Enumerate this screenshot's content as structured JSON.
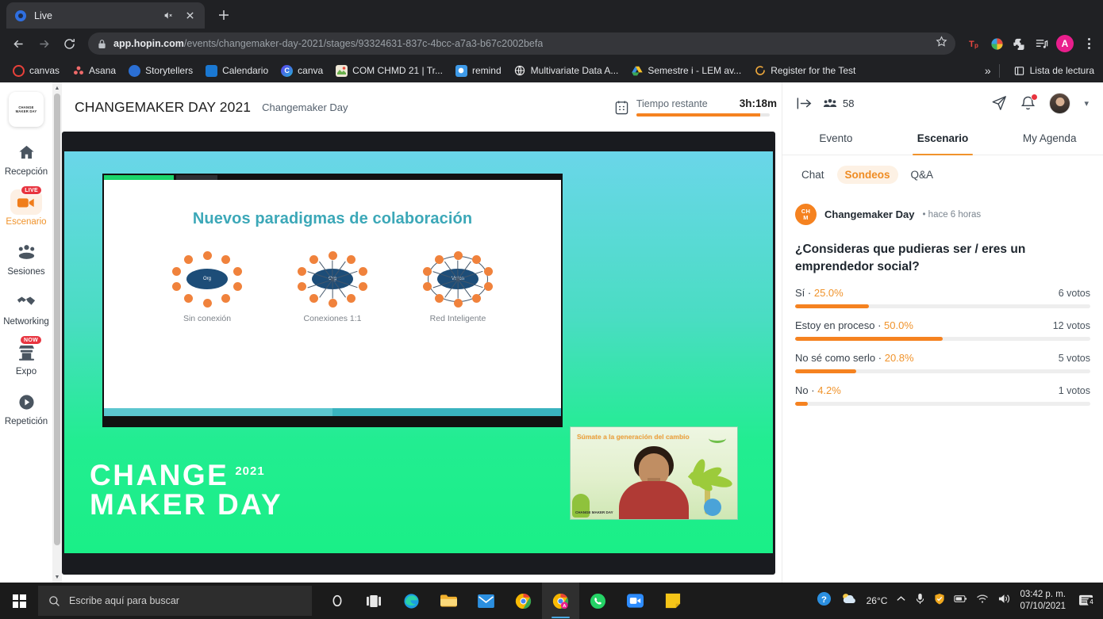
{
  "browser": {
    "tab": {
      "title": "Live",
      "favicon": "hopin-icon",
      "mute_icon": "mute-icon",
      "close_icon": "close-icon"
    },
    "newtab_icon": "plus-icon",
    "nav": {
      "back_icon": "back-arrow-icon",
      "forward_icon": "forward-arrow-icon",
      "reload_icon": "reload-icon"
    },
    "omnibox": {
      "lock_icon": "lock-icon",
      "url_host": "app.hopin.com",
      "url_path": "/events/changemaker-day-2021/stages/93324631-837c-4bcc-a7a3-b67c2002befa",
      "star_icon": "bookmark-star-icon"
    },
    "extensions": [
      {
        "name": "todoist-extension",
        "glyph": "Tp",
        "color": "#e8473f"
      },
      {
        "name": "color-extension",
        "glyph": "",
        "color": "#22a3e0"
      },
      {
        "name": "puzzle-extensions-icon",
        "glyph": "",
        "color": "#d7d9dc"
      },
      {
        "name": "media-list-icon",
        "glyph": "",
        "color": "#d7d9dc"
      }
    ],
    "profile_initial": "A",
    "menu_icon": "three-dot-menu-icon",
    "bookmarks": [
      {
        "label": "canvas",
        "color": "#e8413a"
      },
      {
        "label": "Asana",
        "color": "#f06a6a"
      },
      {
        "label": "Storytellers",
        "color": "#2b6fd4"
      },
      {
        "label": "Calendario",
        "color": "#1a78d2"
      },
      {
        "label": "canva",
        "color": "#7b3ff2"
      },
      {
        "label": "COM CHMD 21 | Tr...",
        "color": "#e8c34a"
      },
      {
        "label": "remind",
        "color": "#3e9ae8"
      },
      {
        "label": "Multivariate Data A...",
        "color": "#f1f1f1"
      },
      {
        "label": "Semestre i - LEM av...",
        "color": "#f5c026"
      },
      {
        "label": "Register for the Test",
        "color": "#f0a93c"
      }
    ],
    "overflow_label": "»",
    "reading_list": {
      "label": "Lista de lectura",
      "icon": "reading-list-icon"
    }
  },
  "sidebar": {
    "logo_lines": [
      "CHANGE",
      "MAKER DAY"
    ],
    "items": [
      {
        "label": "Recepción",
        "icon": "home-icon",
        "badge": "",
        "active": false
      },
      {
        "label": "Escenario",
        "icon": "video-camera-icon",
        "badge": "LIVE",
        "active": true
      },
      {
        "label": "Sesiones",
        "icon": "people-group-icon",
        "badge": "",
        "active": false
      },
      {
        "label": "Networking",
        "icon": "handshake-icon",
        "badge": "",
        "active": false
      },
      {
        "label": "Expo",
        "icon": "booth-icon",
        "badge": "NOW",
        "active": false
      },
      {
        "label": "Repetición",
        "icon": "play-circle-icon",
        "badge": "",
        "active": false
      }
    ]
  },
  "stage": {
    "header": {
      "event_title": "CHANGEMAKER DAY 2021",
      "stage_name": "Changemaker Day",
      "calendar_icon": "calendar-icon",
      "timer_label": "Tiempo restante",
      "timer_value": "3h:18m",
      "timer_progress": 93
    },
    "slide": {
      "title": "Nuevos paradigmas de colaboración",
      "diagrams": [
        {
          "core": "Org",
          "label": "Sin conexión"
        },
        {
          "core": "Org",
          "label": "Conexiones 1:1"
        },
        {
          "core": "Vision",
          "label": "Red Inteligente"
        }
      ],
      "progress": 50
    },
    "branding": {
      "line1": "CHANGE",
      "year": "2021",
      "line2": "MAKER DAY"
    },
    "webcam": {
      "caption": "Súmate a la generación del cambio",
      "logo": "CHANGE MAKER DAY"
    }
  },
  "rightpanel": {
    "collapse_icon": "collapse-panel-icon",
    "people_icon": "people-icon",
    "people_count": "58",
    "send_icon": "send-paper-plane-icon",
    "bell_icon": "notification-bell-icon",
    "avatar_name": "user-avatar",
    "chevron_icon": "chevron-down-icon",
    "tabs": [
      {
        "label": "Evento",
        "active": false
      },
      {
        "label": "Escenario",
        "active": true
      },
      {
        "label": "My Agenda",
        "active": false
      }
    ],
    "subtabs": [
      {
        "label": "Chat",
        "active": false
      },
      {
        "label": "Sondeos",
        "active": true
      },
      {
        "label": "Q&A",
        "active": false
      }
    ],
    "poll": {
      "author_initials": "CH M",
      "author": "Changemaker Day",
      "meta": "• hace 6 horas",
      "question": "¿Consideras que pudieras ser / eres un emprendedor social?",
      "options": [
        {
          "label": "Sí",
          "pct": "25.0%",
          "votes": "6 votos",
          "fill": 25.0
        },
        {
          "label": "Estoy en proceso",
          "pct": "50.0%",
          "votes": "12 votos",
          "fill": 50.0
        },
        {
          "label": "No sé como serlo",
          "pct": "20.8%",
          "votes": "5 votos",
          "fill": 20.8
        },
        {
          "label": "No",
          "pct": "4.2%",
          "votes": "1 votos",
          "fill": 4.2
        }
      ]
    }
  },
  "taskbar": {
    "start_icon": "windows-start-icon",
    "search_icon": "search-icon",
    "search_placeholder": "Escribe aquí para buscar",
    "icons": [
      {
        "name": "cortana-icon"
      },
      {
        "name": "task-view-icon"
      },
      {
        "name": "edge-icon"
      },
      {
        "name": "file-explorer-icon"
      },
      {
        "name": "mail-icon"
      },
      {
        "name": "chrome-icon"
      },
      {
        "name": "chrome-active-icon"
      },
      {
        "name": "whatsapp-icon"
      },
      {
        "name": "zoom-icon"
      },
      {
        "name": "sticky-notes-icon"
      }
    ],
    "tray": {
      "help_icon": "help-circle-icon",
      "weather_icon": "weather-cloud-sun-icon",
      "temperature": "26°C",
      "chevron_icon": "chevron-up-icon",
      "mic_icon": "microphone-icon",
      "shield_icon": "security-shield-icon",
      "battery_icon": "battery-icon",
      "wifi_icon": "wifi-icon",
      "volume_icon": "volume-icon",
      "time": "03:42 p. m.",
      "date": "07/10/2021",
      "notification_icon": "notification-center-icon",
      "notification_count": "4"
    }
  },
  "colors": {
    "accent": "#f58220",
    "live_badge": "#e8343f",
    "stage_green": "#1aef87",
    "stage_cyan": "#6ad6e9"
  }
}
